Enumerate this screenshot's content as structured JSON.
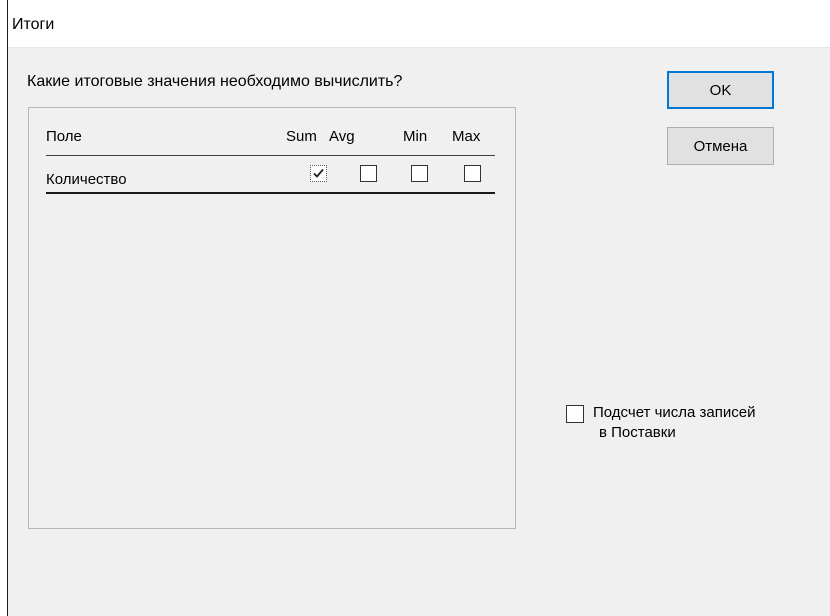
{
  "window": {
    "title": "Итоги"
  },
  "prompt": "Какие итоговые значения необходимо вычислить?",
  "table": {
    "headers": {
      "field": "Поле",
      "sum": "Sum",
      "avg": "Avg",
      "min": "Min",
      "max": "Max"
    },
    "rows": [
      {
        "field": "Количество",
        "sum": true,
        "avg": false,
        "min": false,
        "max": false
      }
    ]
  },
  "buttons": {
    "ok": "OK",
    "cancel": "Отмена"
  },
  "record_count_option": {
    "checked": false,
    "label_line1": "Подсчет числа записей",
    "label_line2": "в Поставки"
  }
}
